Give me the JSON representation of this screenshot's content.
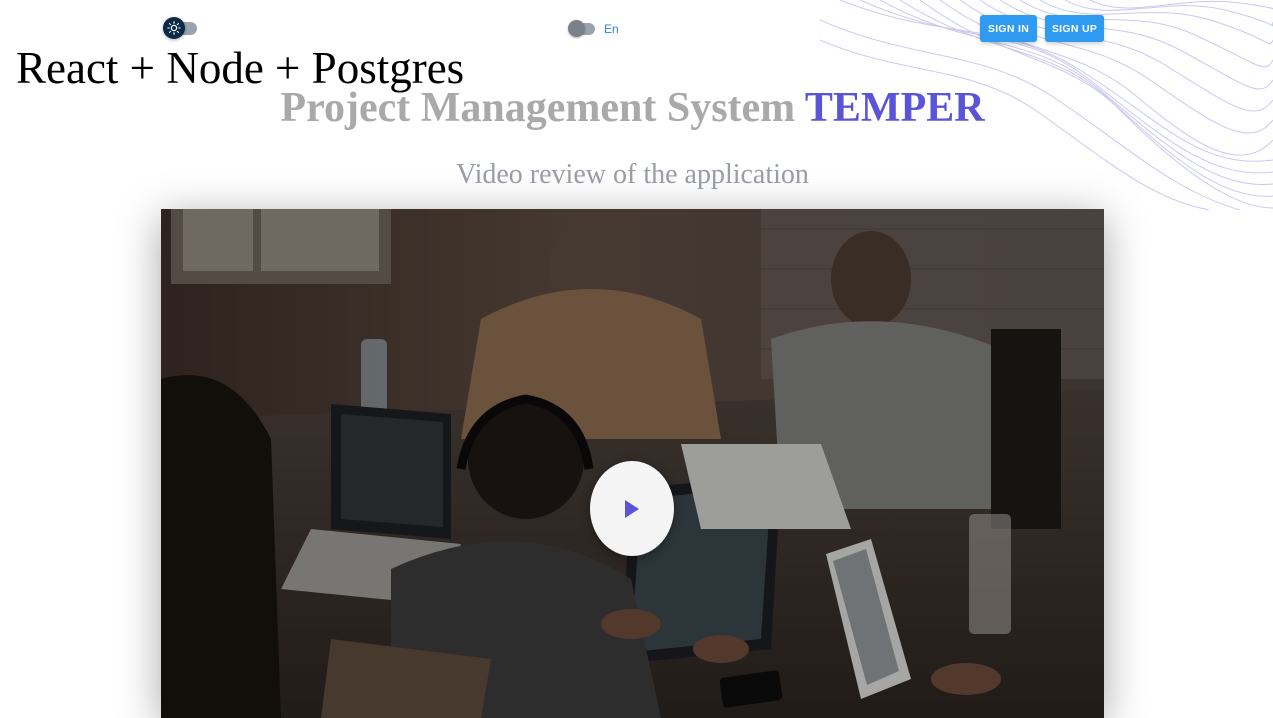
{
  "header": {
    "theme_toggle": {
      "icon": "sun-icon",
      "state": "dark"
    },
    "language_toggle": {
      "label": "En"
    },
    "sign_in_label": "SIGN IN",
    "sign_up_label": "SIGN UP"
  },
  "hero": {
    "stack_title": "React + Node + Postgres",
    "title_prefix": "Project Management System",
    "title_brand": "TEMPER",
    "subtitle": "Video review of the application"
  },
  "video": {
    "play_icon": "play-icon"
  },
  "colors": {
    "accent": "#2f9bf0",
    "brand": "#5a55d8",
    "title_gray": "#a9a9a9",
    "language_label": "#2f87d8"
  }
}
